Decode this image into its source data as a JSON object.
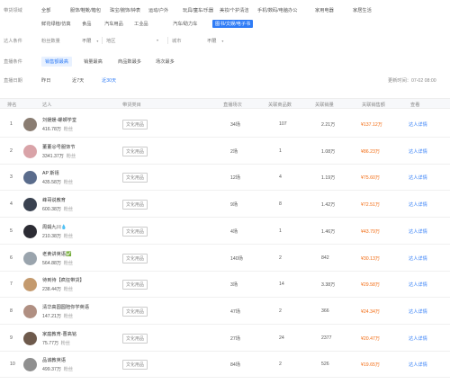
{
  "filters": {
    "category_label": "带货领域",
    "categories": [
      "全部",
      "服饰/鞋靴/箱包",
      "珠宝/腕饰/钟表",
      "运动/户外",
      "玩具/童车/乐器",
      "美妆/个护清洁",
      "手机/数码/电脑办公",
      "家用电器",
      "家居生活",
      "鲜花绿植/仿真",
      "食品",
      "汽车用品",
      "工业品",
      "汽车/助力车",
      "图书/文娱/电子书"
    ],
    "active_category": "图书/文娱/电子书",
    "talent_label": "达人条件",
    "fans_label": "粉丝数量",
    "fans_value": "不限",
    "region_label": "地区",
    "city_label": "城市",
    "city_value": "不限",
    "sort_label": "直播条件",
    "sort_tabs": [
      "销售额最高",
      "销量最高",
      "商品数最多",
      "场次最多"
    ],
    "active_sort": "销售额最高",
    "time_label": "直播日期",
    "time_opts": [
      "昨日",
      "近7天",
      "近30天"
    ],
    "active_time": "近30天",
    "updated": "更新时间：07-02 08:00"
  },
  "table": {
    "headers": [
      "排名",
      "达人",
      "带货类目",
      "直播场次",
      "关联商品数",
      "关联销量",
      "关联销售额",
      "查看"
    ],
    "rows": [
      {
        "rank": "1",
        "name": "刘媛媛-螺蛳学堂",
        "fans": "416.78万",
        "fans_unit": "粉丝",
        "category": "文化用品",
        "sessions": "34场",
        "products": "107",
        "sales": "2.21万",
        "amount": "¥137.12万",
        "detail": "达人详情",
        "color": "#8a7d72"
      },
      {
        "rank": "2",
        "name": "董董😜号服饰节",
        "fans": "3341.37万",
        "fans_unit": "粉丝",
        "category": "文化用品",
        "sessions": "2场",
        "products": "1",
        "sales": "1.08万",
        "amount": "¥86.23万",
        "detail": "达人详情",
        "color": "#d9a3a8"
      },
      {
        "rank": "3",
        "name": "AP 斯禧",
        "fans": "435.58万",
        "fans_unit": "粉丝",
        "category": "文化用品",
        "sessions": "12场",
        "products": "4",
        "sales": "1.19万",
        "amount": "¥75.60万",
        "detail": "达人详情",
        "color": "#5a6c8c"
      },
      {
        "rank": "4",
        "name": "峰哥说教育",
        "fans": "600.38万",
        "fans_unit": "粉丝",
        "category": "文化用品",
        "sessions": "9场",
        "products": "8",
        "sales": "1.42万",
        "amount": "¥72.51万",
        "detail": "达人详情",
        "color": "#3a4250"
      },
      {
        "rank": "5",
        "name": "周娟九川💧",
        "fans": "210.38万",
        "fans_unit": "粉丝",
        "category": "文化用品",
        "sessions": "4场",
        "products": "1",
        "sales": "1.46万",
        "amount": "¥43.79万",
        "detail": "达人详情",
        "color": "#2c2c34"
      },
      {
        "rank": "6",
        "name": "老黄讲英语✅",
        "fans": "564.88万",
        "fans_unit": "粉丝",
        "category": "文化用品",
        "sessions": "140场",
        "products": "2",
        "sales": "842",
        "amount": "¥30.13万",
        "detail": "达人详情",
        "color": "#9aa4ad"
      },
      {
        "rank": "7",
        "name": "待到待【疯狂带货】",
        "fans": "238.44万",
        "fans_unit": "粉丝",
        "category": "文化用品",
        "sessions": "3场",
        "products": "14",
        "sales": "3.38万",
        "amount": "¥29.58万",
        "detail": "达人详情",
        "color": "#c49a6e"
      },
      {
        "rank": "8",
        "name": "清华高圆圆陪你学英语",
        "fans": "147.21万",
        "fans_unit": "粉丝",
        "category": "文化用品",
        "sessions": "47场",
        "products": "2",
        "sales": "366",
        "amount": "¥24.34万",
        "detail": "达人详情",
        "color": "#b08f82"
      },
      {
        "rank": "9",
        "name": "家庭教育-曹高铭",
        "fans": "75.77万",
        "fans_unit": "粉丝",
        "category": "文化用品",
        "sessions": "27场",
        "products": "24",
        "sales": "2377",
        "amount": "¥20.47万",
        "detail": "达人详情",
        "color": "#6e5a4c"
      },
      {
        "rank": "10",
        "name": "品诚教英语",
        "fans": "499.37万",
        "fans_unit": "粉丝",
        "category": "文化用品",
        "sessions": "84场",
        "products": "2",
        "sales": "526",
        "amount": "¥19.65万",
        "detail": "达人详情",
        "color": "#8f8f8f"
      }
    ]
  }
}
